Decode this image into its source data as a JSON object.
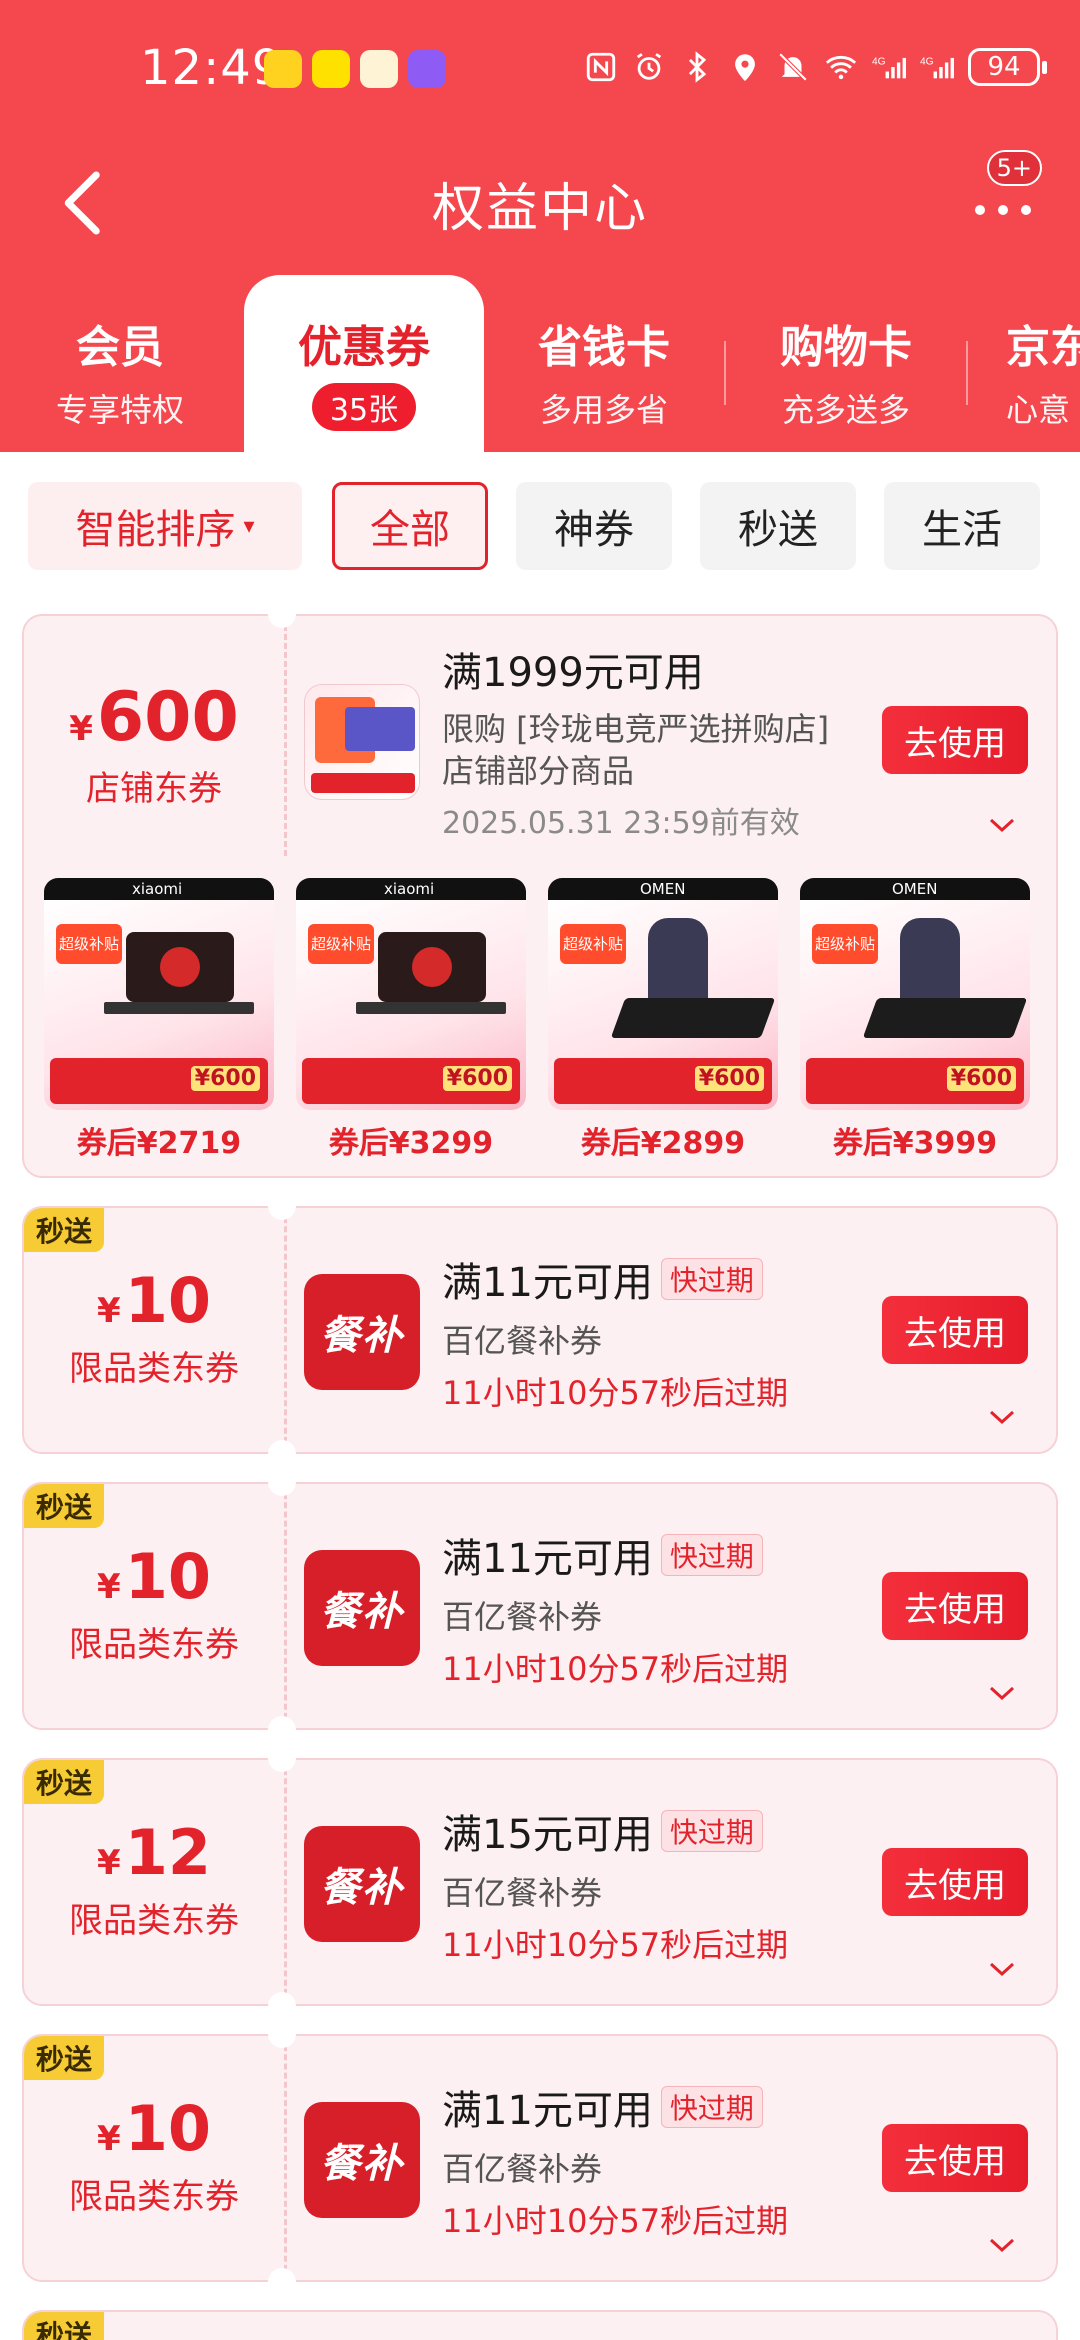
{
  "status_bar": {
    "time": "12:49",
    "battery": "94"
  },
  "nav": {
    "title": "权益中心",
    "badge": "5+"
  },
  "tabs": [
    {
      "title": "会员",
      "sub": "专享特权"
    },
    {
      "title": "优惠券",
      "sub": "35张"
    },
    {
      "title": "省钱卡",
      "sub": "多用多省"
    },
    {
      "title": "购物卡",
      "sub": "充多送多"
    },
    {
      "title": "京东",
      "sub": "心意"
    }
  ],
  "filters": {
    "sort": "智能排序",
    "chips": [
      "全部",
      "神券",
      "秒送",
      "生活"
    ]
  },
  "store_coupon": {
    "amount": "600",
    "currency": "¥",
    "kind": "店铺东券",
    "title": "满1999元可用",
    "desc_line1": "限购 [玲珑电竞严选拼购店]",
    "desc_line2": "店铺部分商品",
    "validity": "2025.05.31 23:59前有效",
    "button": "去使用",
    "products": [
      {
        "price": "券后¥2719",
        "brand": "xiaomi"
      },
      {
        "price": "券后¥3299",
        "brand": "xiaomi"
      },
      {
        "price": "券后¥2899",
        "brand": "OMEN"
      },
      {
        "price": "券后¥3999",
        "brand": "OMEN"
      }
    ],
    "product_badge": "¥600",
    "product_banner": "超级补贴"
  },
  "coupons": [
    {
      "tag": "秒送",
      "amount": "10",
      "kind": "限品类东券",
      "title": "满11元可用",
      "expire_tag": "快过期",
      "sub": "百亿餐补券",
      "time": "11小时10分57秒后过期",
      "button": "去使用",
      "icon_text": "餐补"
    },
    {
      "tag": "秒送",
      "amount": "10",
      "kind": "限品类东券",
      "title": "满11元可用",
      "expire_tag": "快过期",
      "sub": "百亿餐补券",
      "time": "11小时10分57秒后过期",
      "button": "去使用",
      "icon_text": "餐补"
    },
    {
      "tag": "秒送",
      "amount": "12",
      "kind": "限品类东券",
      "title": "满15元可用",
      "expire_tag": "快过期",
      "sub": "百亿餐补券",
      "time": "11小时10分57秒后过期",
      "button": "去使用",
      "icon_text": "餐补"
    },
    {
      "tag": "秒送",
      "amount": "10",
      "kind": "限品类东券",
      "title": "满11元可用",
      "expire_tag": "快过期",
      "sub": "百亿餐补券",
      "time": "11小时10分57秒后过期",
      "button": "去使用",
      "icon_text": "餐补"
    }
  ],
  "partial_tag": "秒送"
}
